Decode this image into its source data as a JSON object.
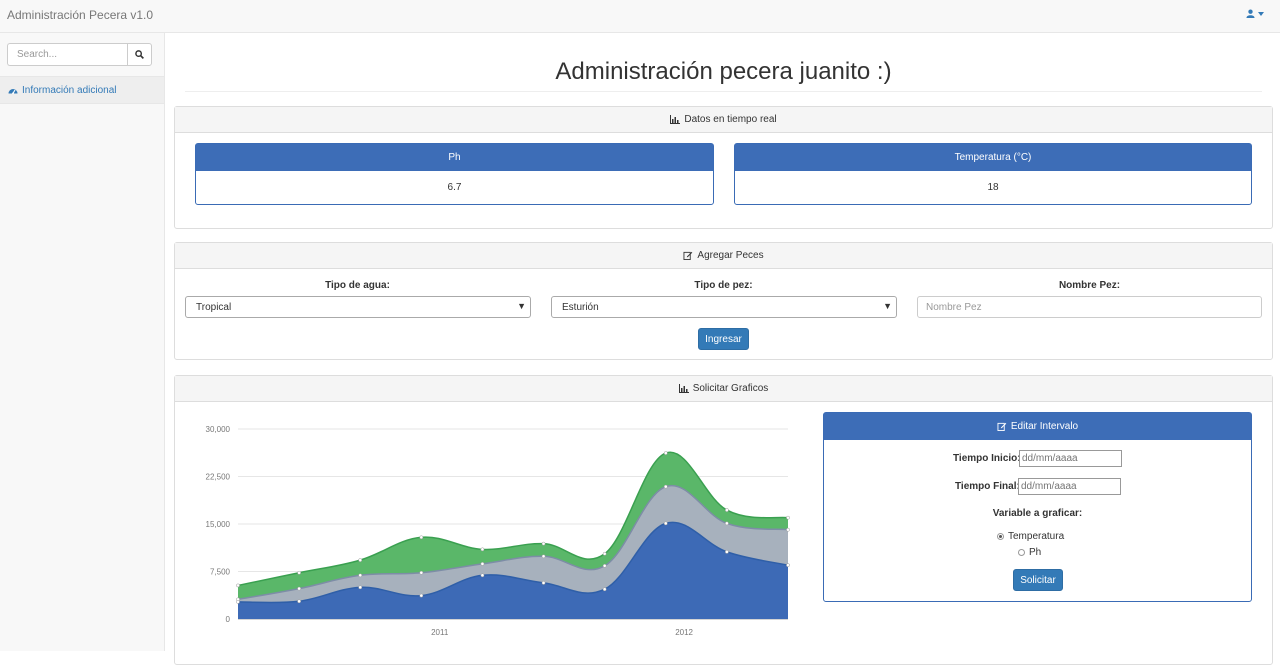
{
  "app": {
    "title": "Administración Pecera v1.0",
    "user_icon": "user-icon",
    "accent": "#337ab7"
  },
  "sidebar": {
    "search_placeholder": "Search...",
    "items": [
      {
        "label": "Información adicional",
        "icon": "dashboard-icon"
      }
    ]
  },
  "page": {
    "title": "Administración pecera juanito :)"
  },
  "realtime": {
    "heading": "Datos en tiempo real",
    "ph_label": "Ph",
    "ph_value": "6.7",
    "temp_label": "Temperatura (°C)",
    "temp_value": "18"
  },
  "add_fish": {
    "heading": "Agregar Peces",
    "water_label": "Tipo de agua:",
    "water_value": "Tropical",
    "fish_label": "Tipo de pez:",
    "fish_value": "Esturión",
    "name_label": "Nombre Pez:",
    "name_placeholder": "Nombre Pez",
    "submit": "Ingresar"
  },
  "charts": {
    "heading": "Solicitar Graficos"
  },
  "interval": {
    "heading": "Editar Intervalo",
    "start_label": "Tiempo Inicio:",
    "start_placeholder": "dd/mm/aaaa",
    "end_label": "Tiempo Final:",
    "end_placeholder": "dd/mm/aaaa",
    "variable_label": "Variable a graficar:",
    "options": [
      "Temperatura",
      "Ph"
    ],
    "selected": "Temperatura",
    "submit": "Solicitar"
  },
  "chart_data": {
    "type": "area",
    "stacked": true,
    "x_ticks": [
      "2011",
      "2012"
    ],
    "y_ticks": [
      "0",
      "7,500",
      "15,000",
      "22,500",
      "30,000"
    ],
    "ylim": [
      0,
      30000
    ],
    "grid": true,
    "x": [
      0,
      1,
      2,
      3,
      4,
      5,
      6,
      7,
      8,
      9
    ],
    "series": [
      {
        "color": "#3d6ab6",
        "values": [
          2700,
          2800,
          5000,
          3700,
          6900,
          5700,
          4700,
          15100,
          10600,
          8500
        ]
      },
      {
        "color": "#a7b1bd",
        "values": [
          400,
          2000,
          1900,
          3600,
          1800,
          4200,
          3700,
          5800,
          4500,
          5600
        ]
      },
      {
        "color": "#5ab769",
        "values": [
          2200,
          2500,
          2400,
          5600,
          2300,
          2000,
          1900,
          5300,
          2100,
          1900
        ]
      }
    ]
  }
}
